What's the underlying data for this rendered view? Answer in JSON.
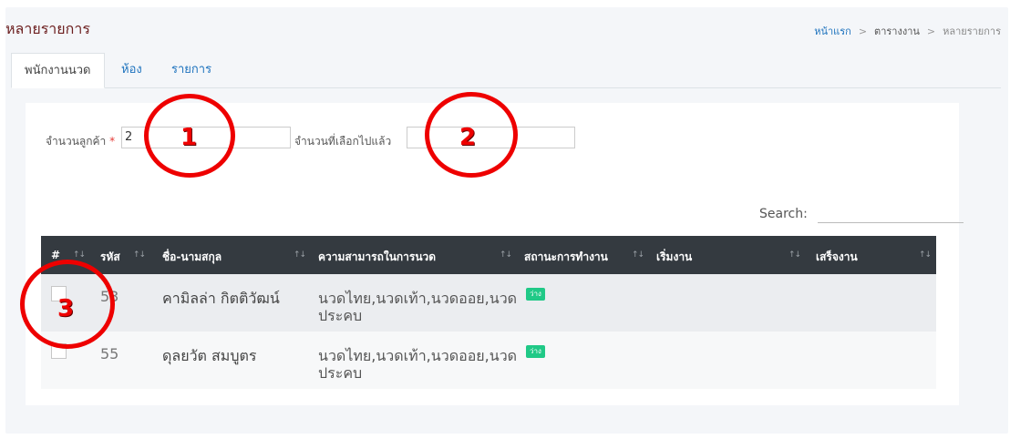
{
  "header": {
    "title": "หลายรายการ",
    "breadcrumb": [
      "หน้าแรก",
      "ตารางงาน",
      "หลายรายการ"
    ],
    "breadcrumb_sep": ">"
  },
  "tabs": [
    {
      "label": "พนักงานนวด",
      "active": true
    },
    {
      "label": "ห้อง",
      "active": false
    },
    {
      "label": "รายการ",
      "active": false
    }
  ],
  "form": {
    "customer_count_label": "จำนวนลูกค้า",
    "required_mark": "*",
    "customer_count_value": "2",
    "selected_count_label": "จำนวนที่เลือกไปแล้ว",
    "selected_count_value": ""
  },
  "search": {
    "label": "Search:",
    "value": ""
  },
  "table": {
    "columns": [
      "#",
      "รหัส",
      "ชื่อ-นามสกุล",
      "ความสามารถในการนวด",
      "สถานะการทำงาน",
      "เริ่มงาน",
      "เสร็จงาน"
    ],
    "sort_icon": "↑↓",
    "rows": [
      {
        "checked": false,
        "code": "53",
        "name": "คามิลล่า กิตติวัฒน์",
        "skills": [
          "นวดไทย,นวดเท้า,นวดออย,นวด",
          "ประคบ"
        ],
        "status": "ว่าง",
        "start": "",
        "end": ""
      },
      {
        "checked": false,
        "code": "55",
        "name": "ดุลยวัต สมบูตร",
        "skills": [
          "นวดไทย,นวดเท้า,นวดออย,นวด",
          "ประคบ"
        ],
        "status": "ว่าง",
        "start": "",
        "end": ""
      }
    ]
  },
  "annotations": [
    "1",
    "2",
    "3"
  ],
  "colors": {
    "accent": "#1e73be",
    "title": "#6b1d1d",
    "header_bg": "#343a40",
    "status_badge": "#20c987",
    "annotation": "#ee0000"
  }
}
